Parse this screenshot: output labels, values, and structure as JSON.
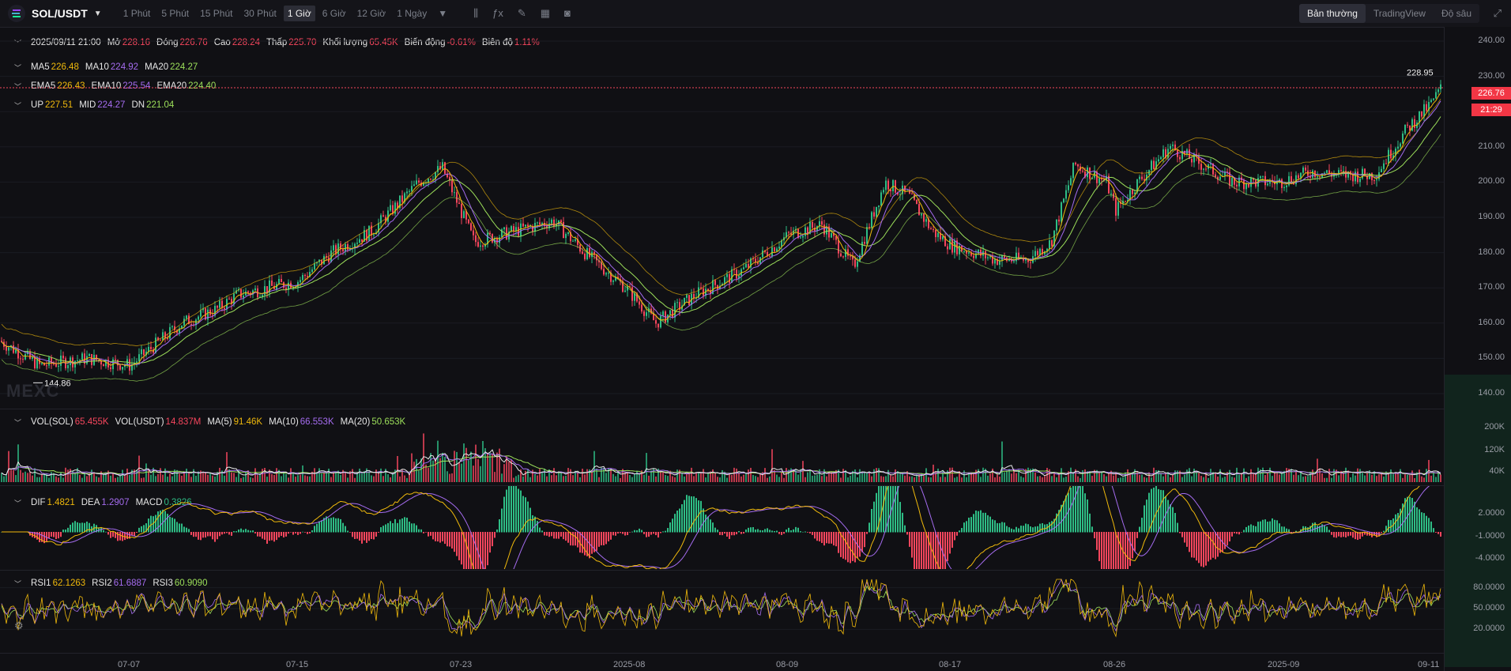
{
  "header": {
    "pair": "SOL/USDT",
    "intervals": [
      "1 Phút",
      "5 Phút",
      "15 Phút",
      "30 Phút",
      "1 Giờ",
      "6 Giờ",
      "12 Giờ",
      "1 Ngày"
    ],
    "active_interval": "1 Giờ",
    "views": [
      "Bản thường",
      "TradingView",
      "Độ sâu"
    ],
    "active_view": "Bản thường"
  },
  "ohlc": {
    "date": "2025/09/11 21:00",
    "open_label": "Mở",
    "open": "228.16",
    "close_label": "Đóng",
    "close": "226.76",
    "high_label": "Cao",
    "high": "228.24",
    "low_label": "Thấp",
    "low": "225.70",
    "volume_label": "Khối lượng",
    "volume": "65.45K",
    "change_label": "Biến động",
    "change": "-0.61%",
    "amp_label": "Biên độ",
    "amp": "1.11%"
  },
  "ma": {
    "ma5_label": "MA5",
    "ma5": "226.48",
    "ma10_label": "MA10",
    "ma10": "224.92",
    "ma20_label": "MA20",
    "ma20": "224.27"
  },
  "ema": {
    "ema5_label": "EMA5",
    "ema5": "226.43",
    "ema10_label": "EMA10",
    "ema10": "225.54",
    "ema20_label": "EMA20",
    "ema20": "224.40"
  },
  "boll": {
    "up_label": "UP",
    "up": "227.51",
    "mid_label": "MID",
    "mid": "224.27",
    "dn_label": "DN",
    "dn": "221.04"
  },
  "vol": {
    "sol_label": "VOL(SOL)",
    "sol": "65.455K",
    "usdt_label": "VOL(USDT)",
    "usdt": "14.837M",
    "ma5_label": "MA(5)",
    "ma5": "91.46K",
    "ma10_label": "MA(10)",
    "ma10": "66.553K",
    "ma20_label": "MA(20)",
    "ma20": "50.653K"
  },
  "macd": {
    "dif_label": "DIF",
    "dif": "1.4821",
    "dea_label": "DEA",
    "dea": "1.2907",
    "macd_label": "MACD",
    "macd": "0.3826"
  },
  "rsi": {
    "rsi1_label": "RSI1",
    "rsi1": "62.1263",
    "rsi2_label": "RSI2",
    "rsi2": "61.6887",
    "rsi3_label": "RSI3",
    "rsi3": "60.9090"
  },
  "price_axis": [
    "240.00",
    "230.00",
    "220.00",
    "210.00",
    "200.00",
    "190.00",
    "180.00",
    "170.00",
    "160.00",
    "150.00",
    "140.00"
  ],
  "vol_axis": [
    "200K",
    "120K",
    "40K"
  ],
  "macd_axis": [
    "2.0000",
    "-1.0000",
    "-4.0000"
  ],
  "rsi_axis": [
    "80.0000",
    "50.0000",
    "20.0000"
  ],
  "x_labels": [
    "07-07",
    "07-15",
    "07-23",
    "2025-08",
    "08-09",
    "08-17",
    "08-26",
    "2025-09",
    "09-11"
  ],
  "high_marker": "228.95",
  "low_marker": "144.86",
  "current_price": "226.76",
  "countdown": "21:29",
  "watermark": "MEXC",
  "colors": {
    "up": "#2ebd85",
    "down": "#f6465d",
    "ma5": "#f0b90b",
    "ma10": "#a56cf0",
    "ma20": "#9cdf5a"
  },
  "chart_data": {
    "type": "line",
    "title": "",
    "xlabel": "",
    "ylabel": "",
    "x": [
      "07-07",
      "07-15",
      "07-23",
      "2025-08",
      "08-09",
      "08-17",
      "08-26",
      "2025-09",
      "09-11"
    ],
    "ylim": [
      140,
      240
    ],
    "series": [
      {
        "name": "SOL/USDT",
        "values": [
          148,
          170,
          203,
          160,
          183,
          180,
          208,
          200,
          226.76
        ]
      }
    ]
  }
}
